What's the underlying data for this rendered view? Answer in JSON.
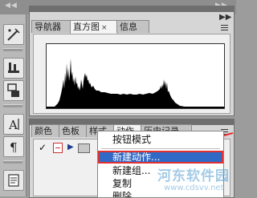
{
  "panels": {
    "top_tabs": [
      {
        "label": "导航器"
      },
      {
        "label": "直方图",
        "close": "×"
      },
      {
        "label": "信息"
      }
    ],
    "bottom_tabs": [
      {
        "label": "颜色"
      },
      {
        "label": "色板"
      },
      {
        "label": "样式"
      },
      {
        "label": "动作"
      },
      {
        "label": "历史记录"
      }
    ]
  },
  "actions_row": {
    "check_mark": "✓"
  },
  "context_menu": {
    "items": [
      {
        "label": "按钮模式"
      },
      {
        "label": "新建动作..."
      },
      {
        "label": "新建组..."
      },
      {
        "label": "复制"
      },
      {
        "label": "删除"
      }
    ]
  },
  "watermark": {
    "main": "河东软件园",
    "url": "www.cdsvv.net"
  },
  "colors": {
    "highlight": "#3169c6",
    "annotation": "#e23030"
  }
}
